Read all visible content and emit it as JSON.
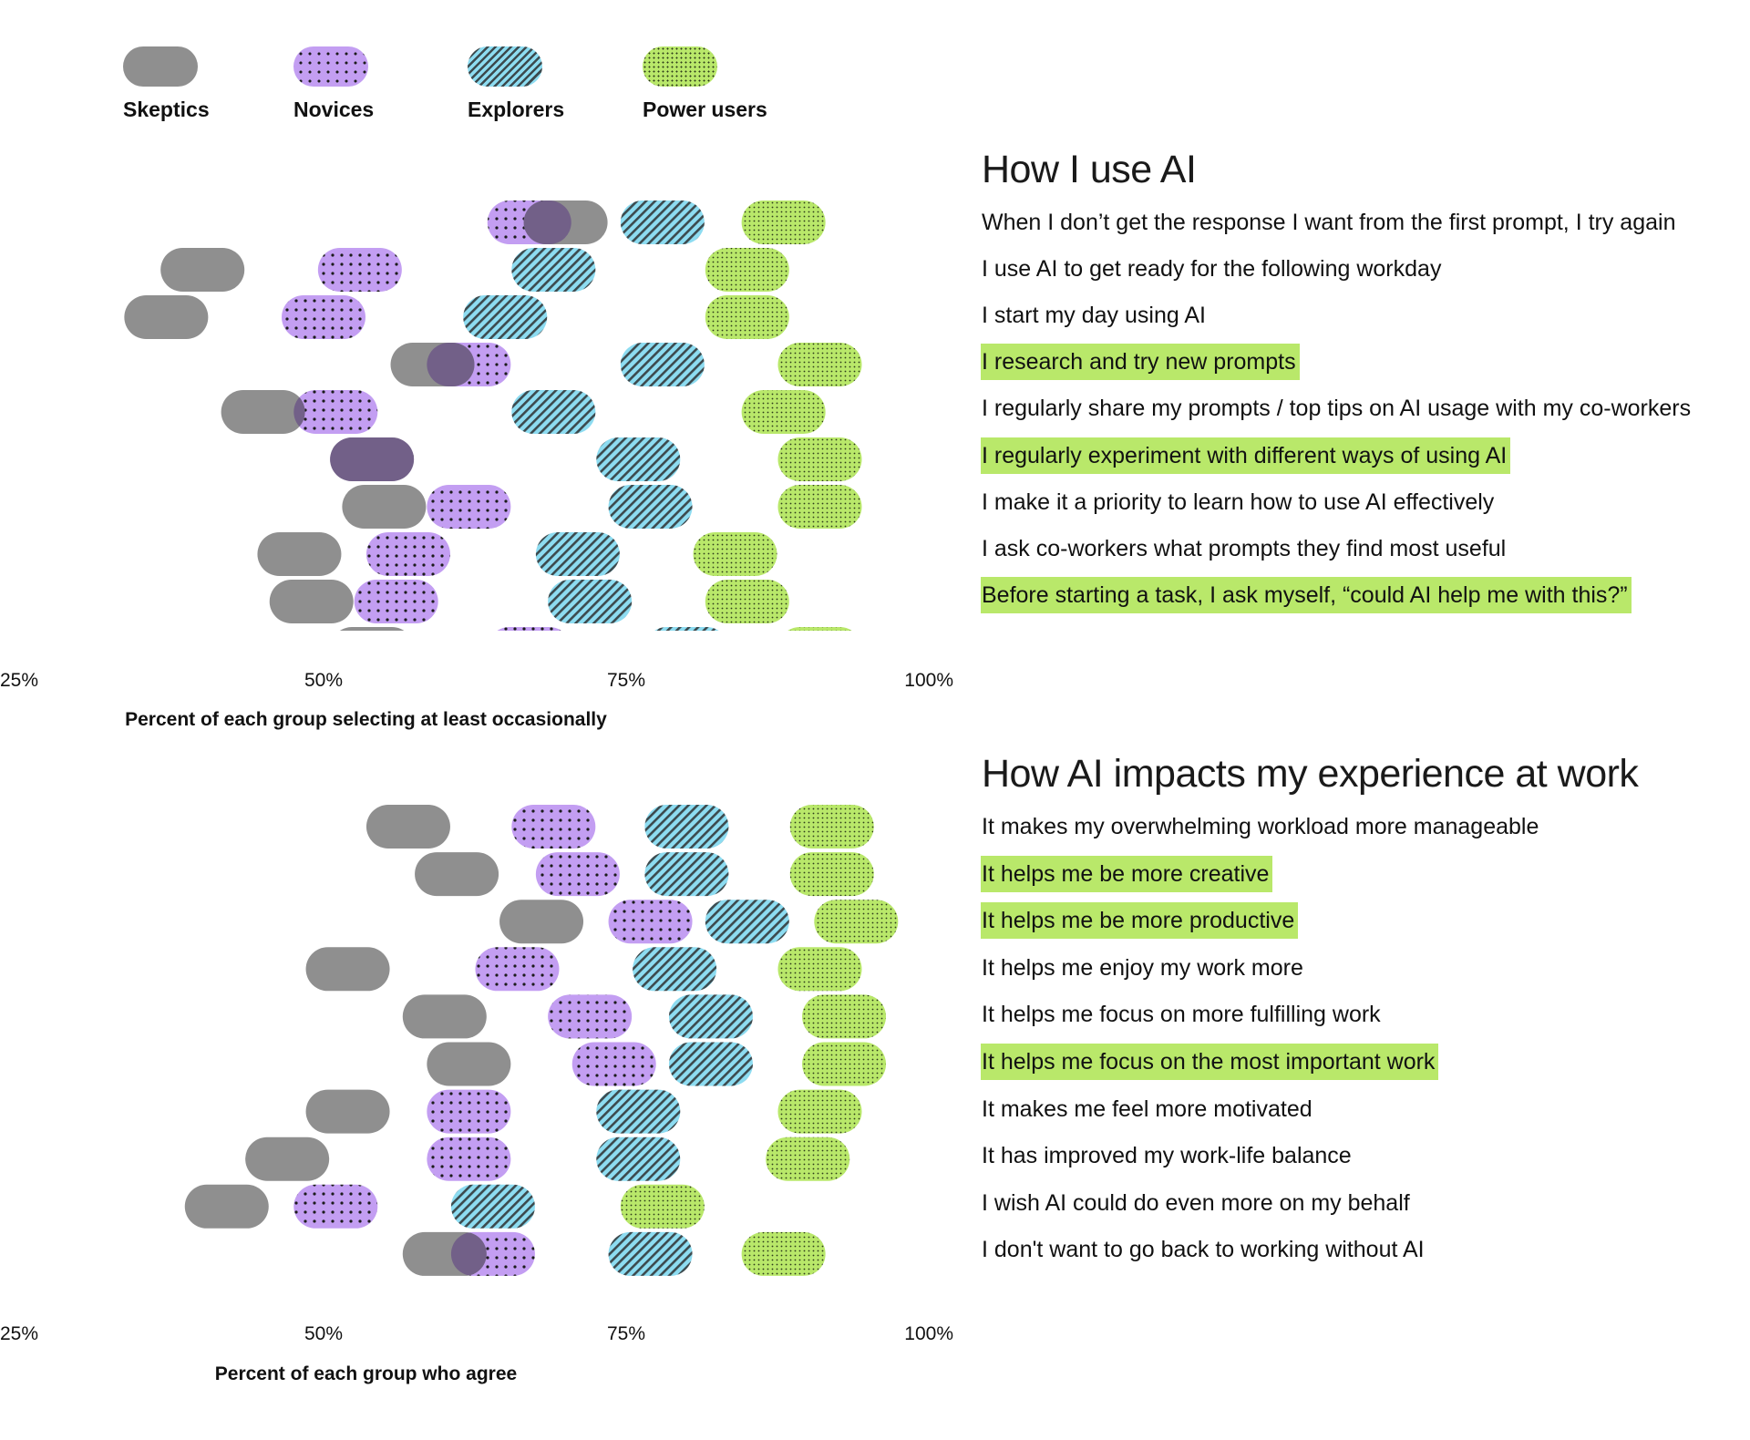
{
  "legend": [
    {
      "key": "skeptics",
      "label": "Skeptics"
    },
    {
      "key": "novices",
      "label": "Novices"
    },
    {
      "key": "explorers",
      "label": "Explorers"
    },
    {
      "key": "power",
      "label": "Power users"
    }
  ],
  "colors": {
    "skeptics": "#8f8f8f",
    "novices": "#c39ef2",
    "explorers": "#8ddcf1",
    "power": "#b9e86a",
    "overlap": "#6e5a88",
    "pattern_ink": "#2e3b3f",
    "highlight": "#b9e86a"
  },
  "panels": [
    {
      "title": "How I use AI",
      "statements": [
        {
          "text": "When I don’t get the response I want from the first prompt, I try again",
          "highlighted": false
        },
        {
          "text": "I use AI to get ready for the following workday",
          "highlighted": false
        },
        {
          "text": "I start my day using AI",
          "highlighted": false
        },
        {
          "text": "I research and try new prompts",
          "highlighted": true
        },
        {
          "text": "I regularly share my prompts / top tips on AI usage with my co-workers",
          "highlighted": false
        },
        {
          "text": "I regularly experiment with different ways of using AI",
          "highlighted": true
        },
        {
          "text": "I make it a priority to learn how to use AI effectively",
          "highlighted": false
        },
        {
          "text": "I ask co-workers what prompts they find most useful",
          "highlighted": false
        },
        {
          "text": "Before starting a task, I ask myself, “could AI help me with this?”",
          "highlighted": true
        }
      ]
    },
    {
      "title": "How AI impacts my experience at work",
      "statements": [
        {
          "text": "It makes my overwhelming workload more manageable",
          "highlighted": false
        },
        {
          "text": "It helps me be more creative",
          "highlighted": true
        },
        {
          "text": "It helps me be more productive",
          "highlighted": true
        },
        {
          "text": "It helps me enjoy my work more",
          "highlighted": false
        },
        {
          "text": "It helps me focus on more fulfilling work",
          "highlighted": false
        },
        {
          "text": "It helps me focus on the most important work",
          "highlighted": true
        },
        {
          "text": "It makes me feel more motivated",
          "highlighted": false
        },
        {
          "text": "It has improved my work-life balance",
          "highlighted": false
        },
        {
          "text": "I wish AI could do even more on my behalf",
          "highlighted": false
        },
        {
          "text": "I don't want to go back to working without AI",
          "highlighted": false
        }
      ]
    }
  ],
  "chart_data": [
    {
      "type": "scatter",
      "subtype": "dot-plot (pill markers)",
      "title": "How I use AI",
      "xlabel": "Percent of each group selecting at least occasionally",
      "ylabel": "",
      "xlim": [
        25,
        100
      ],
      "x_ticks": [
        "25%",
        "50%",
        "75%",
        "100%"
      ],
      "legend_position": "top-left",
      "categories": [
        "When I don’t get the response I want from the first prompt, I try again",
        "I use AI to get ready for the following workday",
        "I start my day using AI",
        "I research and try new prompts",
        "I regularly share my prompts / top tips on AI usage with my co-workers",
        "I regularly experiment with different ways of using AI",
        "I make it a priority to learn how to use AI effectively",
        "I ask co-workers what prompts they find most useful",
        "Before starting a task, I ask myself, “could AI help me with this?”"
      ],
      "series": [
        {
          "name": "Skeptics",
          "key": "skeptics",
          "values": [
            70,
            40,
            37,
            59,
            45,
            54,
            55,
            48,
            49
          ]
        },
        {
          "name": "Novices",
          "key": "novices",
          "values": [
            67,
            53,
            50,
            62,
            51,
            54,
            62,
            57,
            56
          ]
        },
        {
          "name": "Explorers",
          "key": "explorers",
          "values": [
            78,
            69,
            65,
            78,
            69,
            76,
            77,
            71,
            72
          ]
        },
        {
          "name": "Power users",
          "key": "power",
          "values": [
            88,
            85,
            85,
            91,
            88,
            91,
            91,
            84,
            85
          ]
        }
      ],
      "partial_row_clipped": {
        "Skeptics": 54,
        "Novices": 67,
        "Explorers": 80,
        "Power users": 91
      }
    },
    {
      "type": "scatter",
      "subtype": "dot-plot (pill markers)",
      "title": "How AI impacts my experience at work",
      "xlabel": "Percent of each group who agree",
      "ylabel": "",
      "xlim": [
        25,
        100
      ],
      "x_ticks": [
        "25%",
        "50%",
        "75%",
        "100%"
      ],
      "categories": [
        "It makes my overwhelming workload more manageable",
        "It helps me be more creative",
        "It helps me be more productive",
        "It helps me enjoy my work more",
        "It helps me focus on more fulfilling work",
        "It helps me focus on the most important work",
        "It makes me feel more motivated",
        "It has improved my work-life balance",
        "I wish AI could do even more on my behalf",
        "I don't want to go back to working without AI"
      ],
      "series": [
        {
          "name": "Skeptics",
          "key": "skeptics",
          "values": [
            57,
            61,
            68,
            52,
            60,
            62,
            52,
            47,
            42,
            60
          ]
        },
        {
          "name": "Novices",
          "key": "novices",
          "values": [
            69,
            71,
            77,
            66,
            72,
            74,
            62,
            62,
            51,
            64
          ]
        },
        {
          "name": "Explorers",
          "key": "explorers",
          "values": [
            80,
            80,
            85,
            79,
            82,
            82,
            76,
            76,
            64,
            77
          ]
        },
        {
          "name": "Power users",
          "key": "power",
          "values": [
            92,
            92,
            94,
            91,
            93,
            93,
            91,
            90,
            78,
            88
          ]
        }
      ]
    }
  ]
}
